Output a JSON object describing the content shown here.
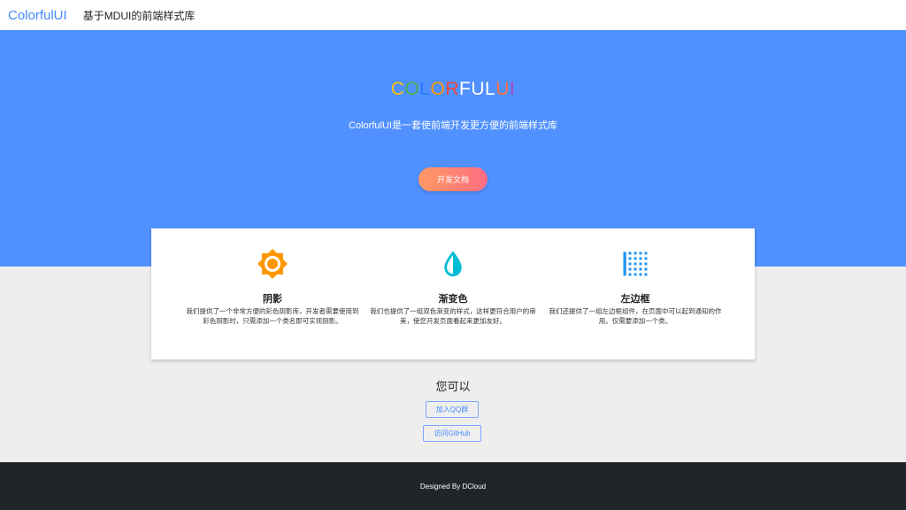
{
  "navbar": {
    "brand": "ColorfulUI",
    "subtitle": "基于MDUI的前端样式库"
  },
  "hero": {
    "title_letters": [
      {
        "ch": "C",
        "color": "#ffc107"
      },
      {
        "ch": "O",
        "color": "#4caf50"
      },
      {
        "ch": "L",
        "color": "#2979ff"
      },
      {
        "ch": "O",
        "color": "#ff9800"
      },
      {
        "ch": "R",
        "color": "#f44336"
      },
      {
        "ch": "F",
        "color": "#ffffff"
      },
      {
        "ch": "U",
        "color": "#ffffff"
      },
      {
        "ch": "L",
        "color": "#ffffff"
      },
      {
        "ch": "U",
        "color": "#ff7043"
      },
      {
        "ch": "I",
        "color": "#ab47bc"
      }
    ],
    "subtitle": "ColorfulUI是一套使前端开发更方便的前端样式库",
    "doc_button": "开发文档"
  },
  "features": [
    {
      "title": "阴影",
      "desc": "我们提供了一个非常方便的彩色阴影库，开发者需要使用到彩色阴影时，只需添加一个类名即可实现阴影。",
      "icon": "brightness-icon",
      "icon_color": "#ff9800"
    },
    {
      "title": "渐变色",
      "desc": "我们也提供了一组双色渐变的样式，这样更符合用户的审美，使您开发页面看起来更加友好。",
      "icon": "tonality-drop-icon",
      "icon_color": "#00bcd4"
    },
    {
      "title": "左边框",
      "desc": "我们还提供了一组左边框组件，在页面中可以起到通知的作用。仅需要添加一个类。",
      "icon": "border-left-icon",
      "icon_color": "#2196f3"
    }
  ],
  "cando": {
    "title": "您可以",
    "qq_button": "加入QQ群",
    "github_button": "访问GitHub"
  },
  "footer": {
    "text": "Designed By DCloud"
  }
}
